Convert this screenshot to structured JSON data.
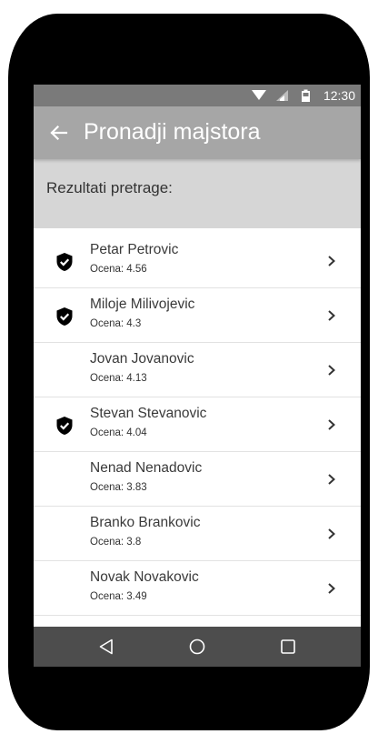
{
  "status_bar": {
    "time": "12:30",
    "icons": [
      "wifi-icon",
      "signal-icon",
      "battery-icon"
    ]
  },
  "app_bar": {
    "title": "Pronadji majstora",
    "back_icon": "arrow-left-icon"
  },
  "results_header": "Rezultati pretrage:",
  "results": [
    {
      "name": "Petar Petrovic",
      "rating": "Ocena: 4.56",
      "verified": true
    },
    {
      "name": "Miloje Milivojevic",
      "rating": "Ocena: 4.3",
      "verified": true
    },
    {
      "name": "Jovan Jovanovic",
      "rating": "Ocena: 4.13",
      "verified": false
    },
    {
      "name": "Stevan Stevanovic",
      "rating": "Ocena: 4.04",
      "verified": true
    },
    {
      "name": "Nenad Nenadovic",
      "rating": "Ocena: 3.83",
      "verified": false
    },
    {
      "name": "Branko Brankovic",
      "rating": "Ocena: 3.8",
      "verified": false
    },
    {
      "name": "Novak Novakovic",
      "rating": "Ocena: 3.49",
      "verified": false
    }
  ],
  "nav_bar": {
    "buttons": [
      "back-triangle-icon",
      "home-circle-icon",
      "recents-square-icon"
    ]
  },
  "colors": {
    "status_bar": "#7a7a7a",
    "app_bar": "#a6a6a6",
    "subheader": "#d6d6d6",
    "nav_bar": "#4d4d4d",
    "device": "#000000"
  }
}
